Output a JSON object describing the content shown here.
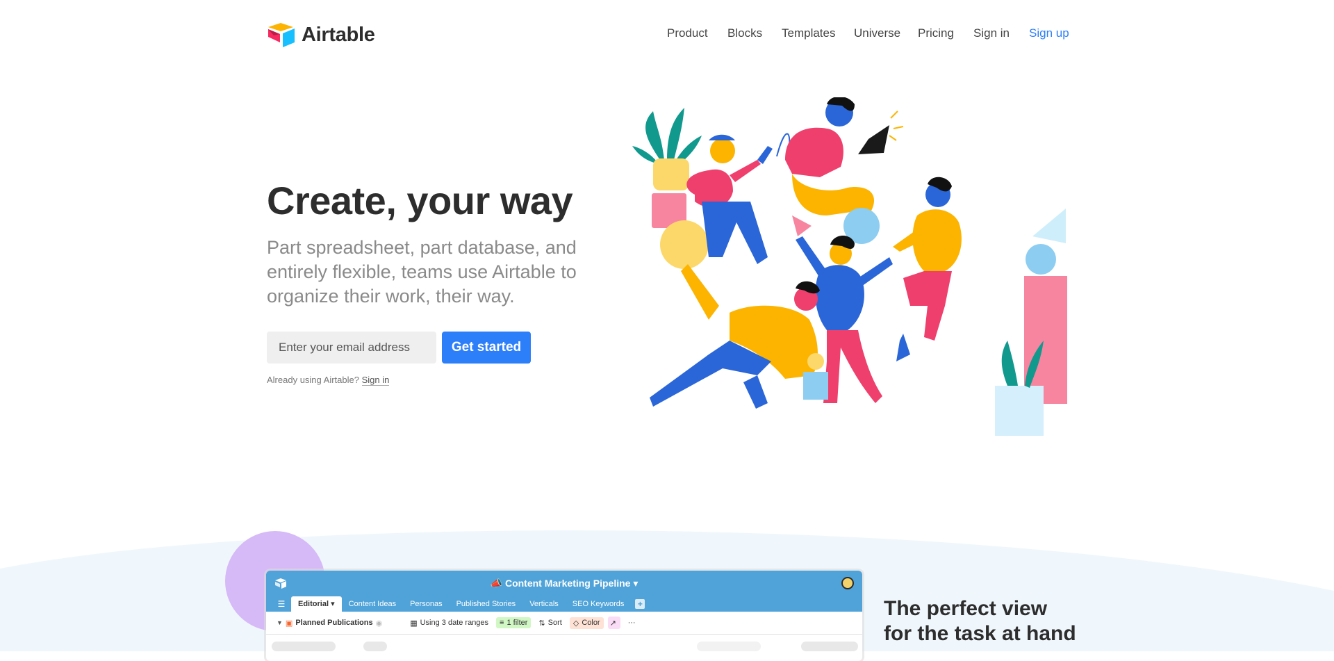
{
  "brand": {
    "name": "Airtable"
  },
  "nav": {
    "items": [
      {
        "label": "Product"
      },
      {
        "label": "Blocks"
      },
      {
        "label": "Templates"
      },
      {
        "label": "Universe"
      },
      {
        "label": "Pricing"
      },
      {
        "label": "Sign in"
      },
      {
        "label": "Sign up"
      }
    ],
    "accent_color": "#2d7ff9"
  },
  "hero": {
    "title": "Create, your way",
    "subtitle": "Part spreadsheet, part database, and entirely flexible, teams use Airtable to organize their work, their way.",
    "email_placeholder": "Enter your email address",
    "cta_label": "Get started",
    "already_text": "Already using Airtable?",
    "already_link": "Sign in"
  },
  "app_preview": {
    "base_title": "Content Marketing Pipeline",
    "tabs": [
      {
        "label": "Editorial",
        "active": true
      },
      {
        "label": "Content Ideas"
      },
      {
        "label": "Personas"
      },
      {
        "label": "Published Stories"
      },
      {
        "label": "Verticals"
      },
      {
        "label": "SEO Keywords"
      }
    ],
    "toolbar": {
      "view_name": "Planned Publications",
      "date_ranges": "Using 3 date ranges",
      "filter": "1 filter",
      "sort": "Sort",
      "color": "Color"
    },
    "header_color": "#4fa3d9"
  },
  "feature": {
    "heading": "The perfect view for the task at hand"
  }
}
